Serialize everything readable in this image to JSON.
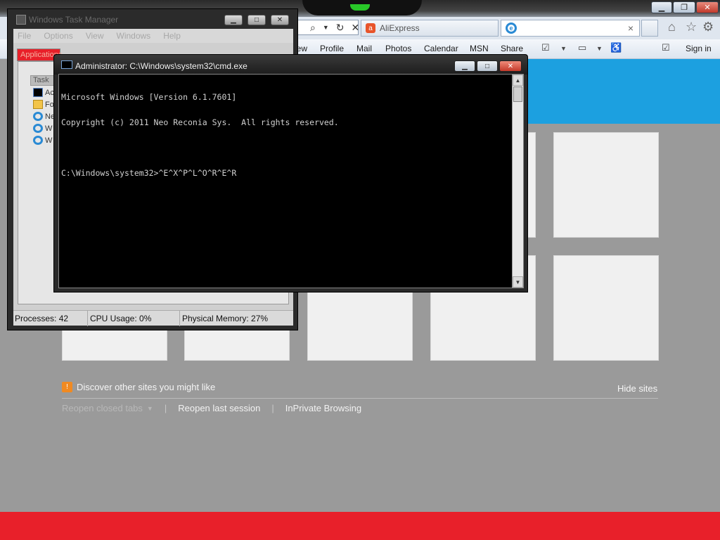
{
  "ie": {
    "tabs": [
      {
        "label": "AliExpress",
        "icon": "aliexpress-icon"
      },
      {
        "label": "",
        "icon": "ie-icon"
      }
    ],
    "command_links": [
      "iew",
      "Profile",
      "Mail",
      "Photos",
      "Calendar",
      "MSN",
      "Share"
    ],
    "sign_in": "Sign in",
    "discover_text": "Discover other sites you might like",
    "hide_sites": "Hide sites",
    "reopen_closed_tabs": "Reopen closed tabs",
    "reopen_last_session": "Reopen last session",
    "inprivate": "InPrivate Browsing",
    "separator": "|"
  },
  "task_manager": {
    "title": "Windows Task Manager",
    "menu": [
      "File",
      "Options",
      "View",
      "Windows",
      "Help"
    ],
    "active_tab": "Applications",
    "list_header": "Task",
    "rows": [
      {
        "label": "Ac",
        "icon": "cmd-app-icon"
      },
      {
        "label": "Fo",
        "icon": "folder-app-icon"
      },
      {
        "label": "Ne",
        "icon": "ie-app-icon"
      },
      {
        "label": "W",
        "icon": "ie-app-icon"
      },
      {
        "label": "W",
        "icon": "ie-app-icon"
      }
    ],
    "status": {
      "processes": "Processes: 42",
      "cpu": "CPU Usage: 0%",
      "memory": "Physical Memory: 27%"
    }
  },
  "cmd": {
    "title": "Administrator: C:\\Windows\\system32\\cmd.exe",
    "lines": [
      "Microsoft Windows [Version 6.1.7601]",
      "Copyright (c) 2011 Neo Reconia Sys.  All rights reserved.",
      "",
      "C:\\Windows\\system32>^E^X^P^L^O^R^E^R"
    ]
  },
  "colors": {
    "accent_blue": "#1ca0e0",
    "bottom_red": "#e8202a"
  }
}
